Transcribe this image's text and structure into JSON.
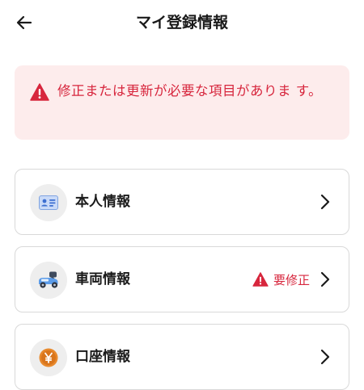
{
  "header": {
    "title": "マイ登録情報",
    "back_icon": "arrow-left-icon"
  },
  "alert": {
    "icon": "warning-triangle-icon",
    "message": "修正または更新が必要な項目がありま す。",
    "color": "#d7263d",
    "background": "#fdecec"
  },
  "items": [
    {
      "label": "本人情報",
      "icon": "id-card-icon"
    },
    {
      "label": "車両情報",
      "icon": "scooter-icon",
      "status": "要修正",
      "status_icon": "warning-triangle-icon"
    },
    {
      "label": "口座情報",
      "icon": "yen-coin-icon"
    }
  ]
}
